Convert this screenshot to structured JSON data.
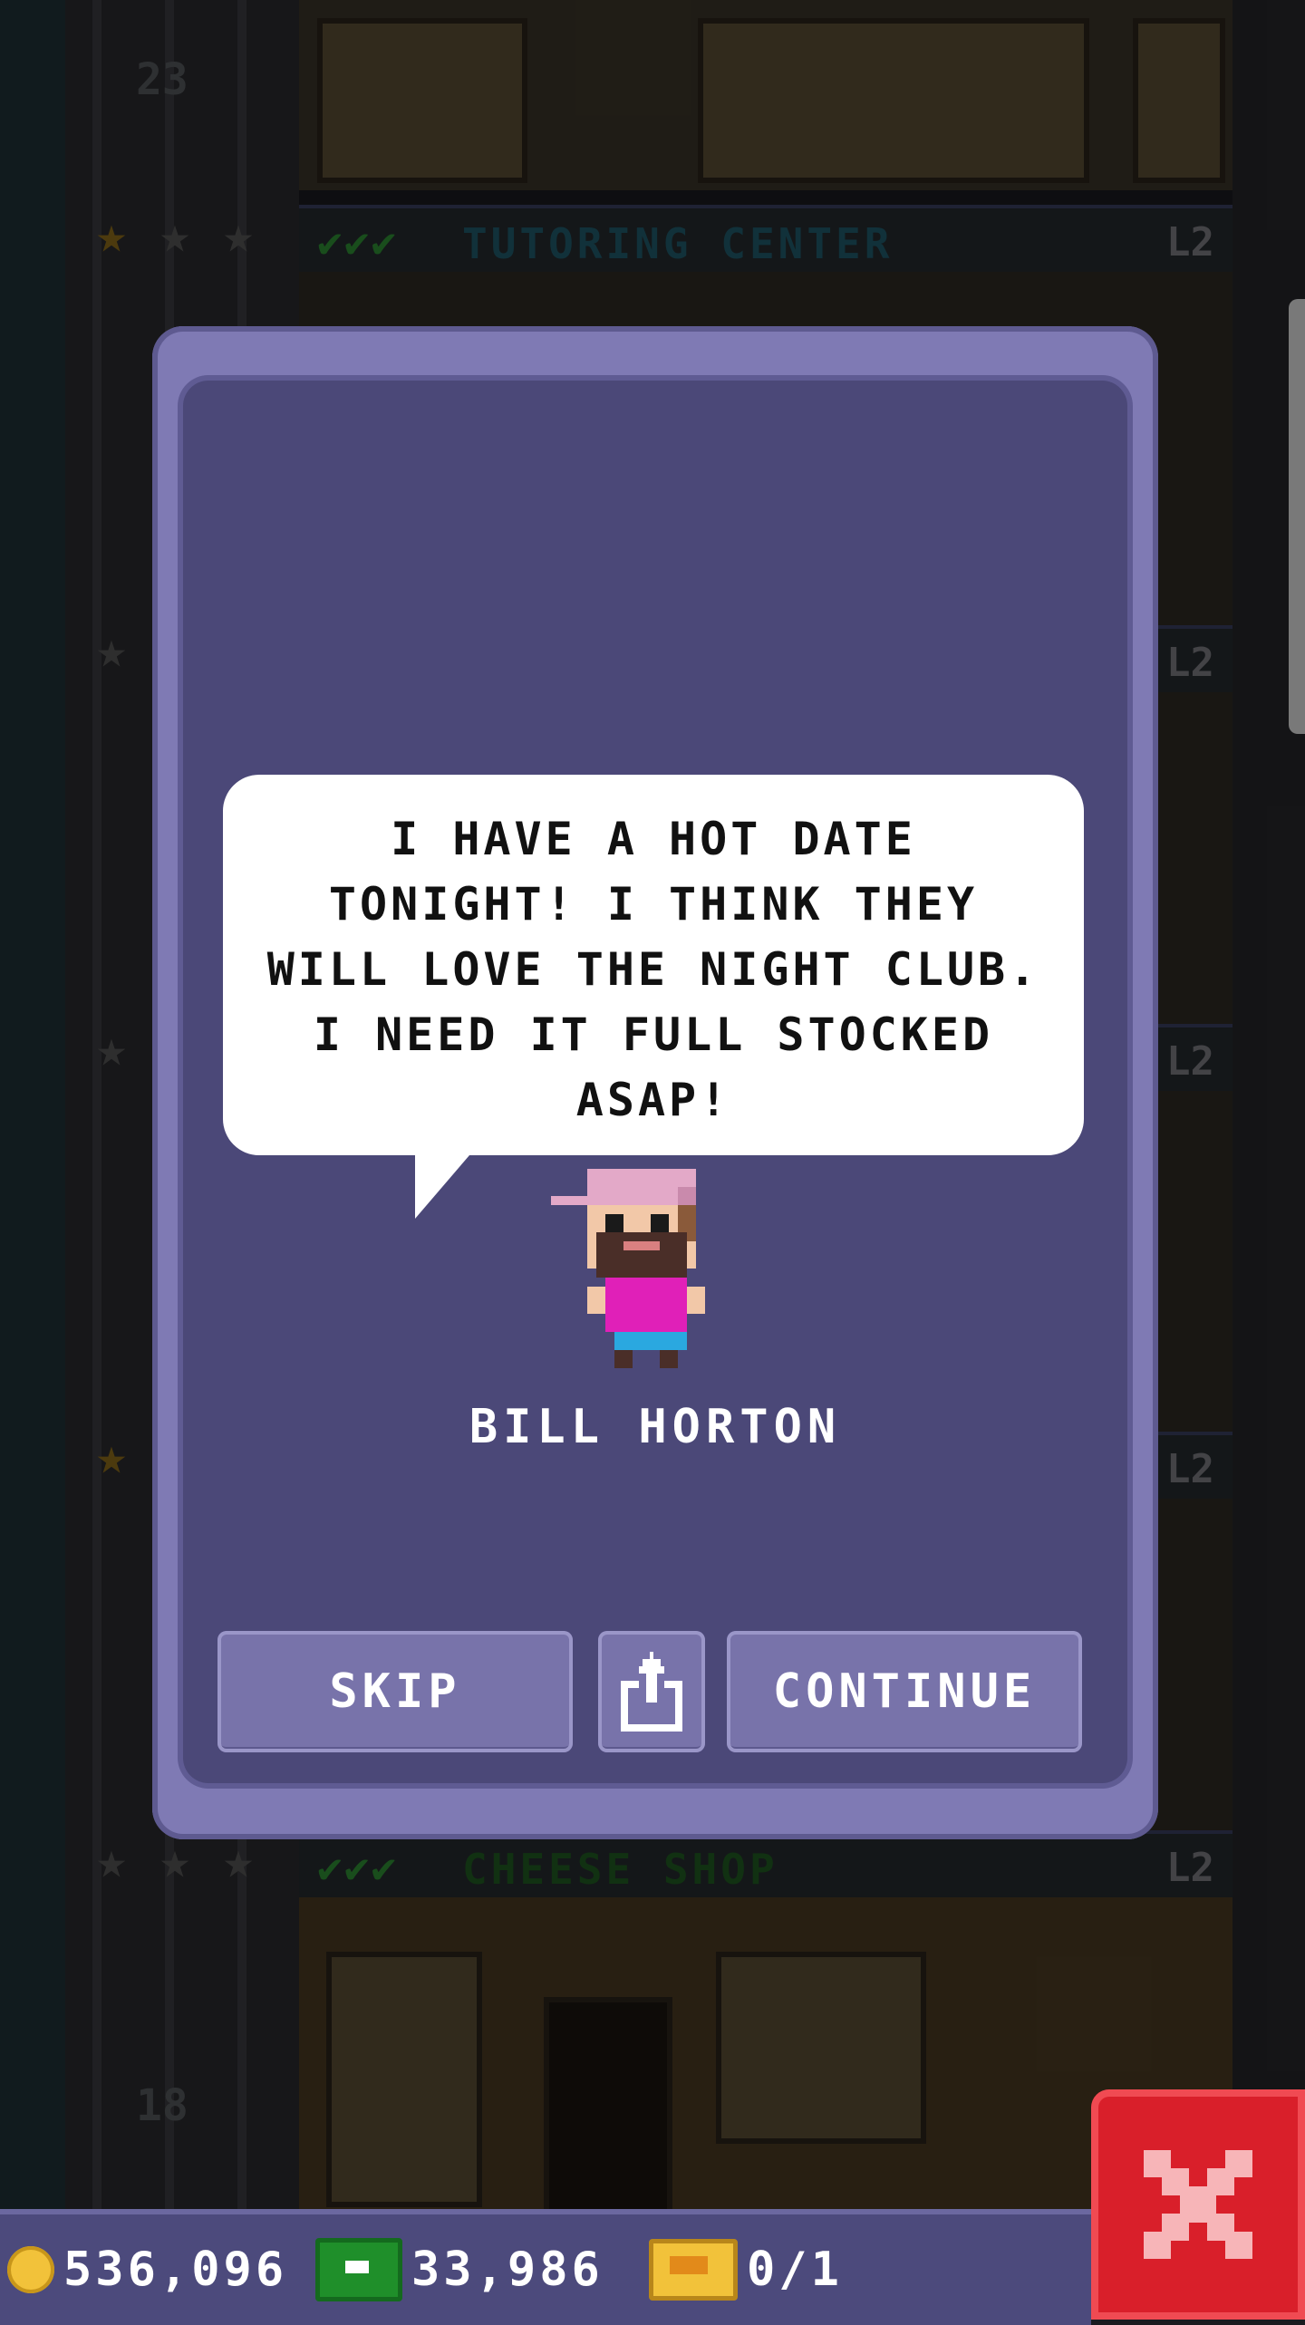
{
  "background": {
    "top_floor": {
      "number": "23",
      "name": "TUTORING CENTER",
      "level": "L2",
      "checks": "✔✔✔"
    },
    "bottom_floor": {
      "number": "18",
      "name": "CHEESE SHOP",
      "level": "L2",
      "checks": "✔✔✔"
    },
    "side_levels": [
      "L2",
      "L2",
      "L2"
    ],
    "colors": {
      "tutoring_center": "#1f5a6a",
      "cheese_shop": "#1f5a22"
    }
  },
  "dialog": {
    "speech": "I HAVE A HOT DATE TONIGHT! I THINK THEY WILL LOVE THE NIGHT CLUB. I NEED IT FULL STOCKED ASAP!",
    "character_name": "BILL HORTON",
    "buttons": {
      "skip": "SKIP",
      "share_icon": "share-icon",
      "continue": "CONTINUE"
    }
  },
  "close_button": {
    "icon": "close-icon"
  },
  "hud": {
    "coins": "536,096",
    "bux": "33,986",
    "tickets": "0/1"
  }
}
